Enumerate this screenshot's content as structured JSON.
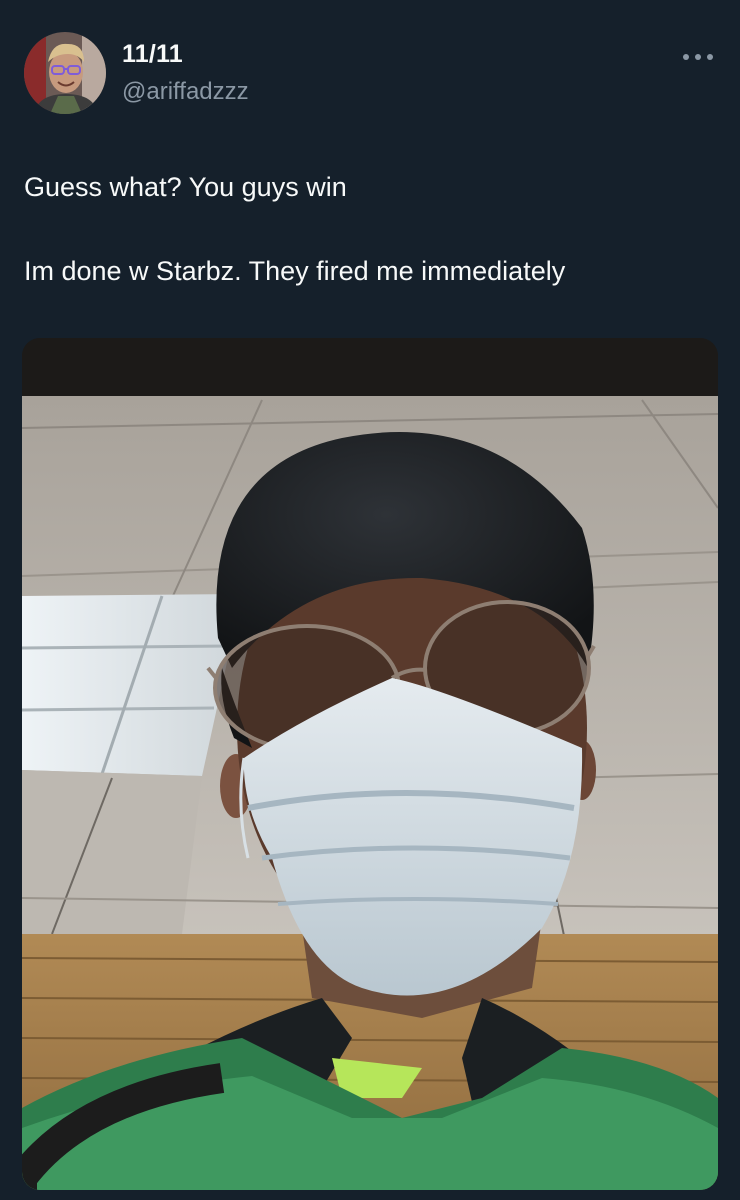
{
  "tweet": {
    "author": {
      "display_name": "11/11",
      "handle": "@ariffadzzz",
      "avatar_icon": "profile-photo"
    },
    "more_icon": "ellipsis-icon",
    "text_lines": [
      "Guess what? You guys win",
      "Im done w Starbz. They fired me immediately"
    ],
    "media": {
      "type": "photo",
      "description_icon": "selfie-photo"
    }
  },
  "colors": {
    "background": "#15202b",
    "primary_text": "#f7f9f9",
    "secondary_text": "#8b98a5"
  }
}
